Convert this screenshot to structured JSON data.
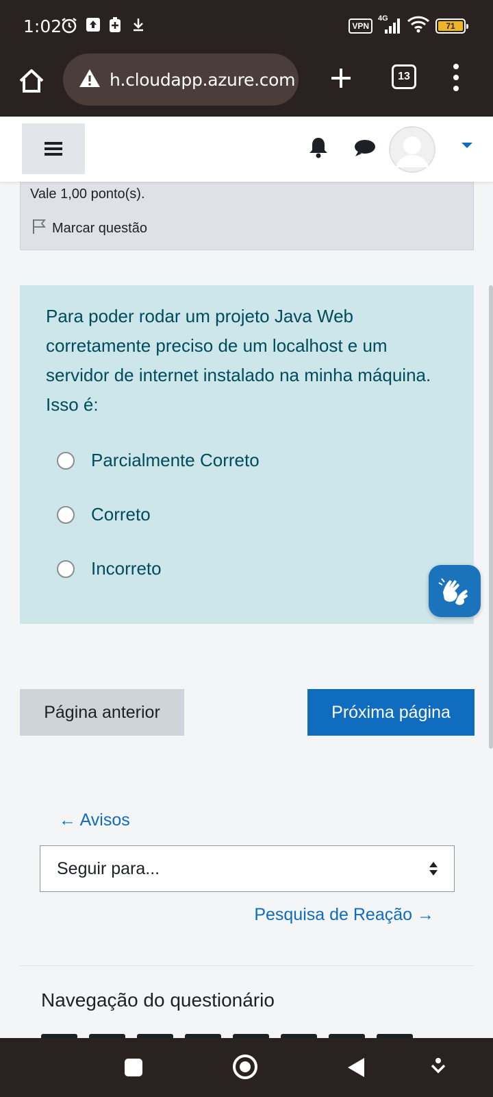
{
  "status_bar": {
    "time": "1:02",
    "vpn": "VPN",
    "network": "4G",
    "battery": "71"
  },
  "browser": {
    "url": "h.cloudapp.azure.com",
    "tab_count": "13"
  },
  "question_info": {
    "points": "Vale 1,00 ponto(s).",
    "flag_label": "Marcar questão"
  },
  "question": {
    "text": "Para poder rodar um projeto Java Web corretamente preciso de um localhost e um servidor de internet instalado na minha máquina. Isso é:",
    "options": [
      "Parcialmente Correto",
      "Correto",
      "Incorreto"
    ]
  },
  "navigation": {
    "prev_button": "Página anterior",
    "next_button": "Próxima página",
    "prev_link": "← Avisos",
    "jump_select": "Seguir para...",
    "next_link": "Pesquisa de Reação →",
    "quiz_nav_title": "Navegação do questionário"
  },
  "colors": {
    "primary": "#0f6cbf",
    "question_bg": "#cce6ea",
    "question_text": "#004b5c",
    "system_bar": "#2a2220"
  }
}
